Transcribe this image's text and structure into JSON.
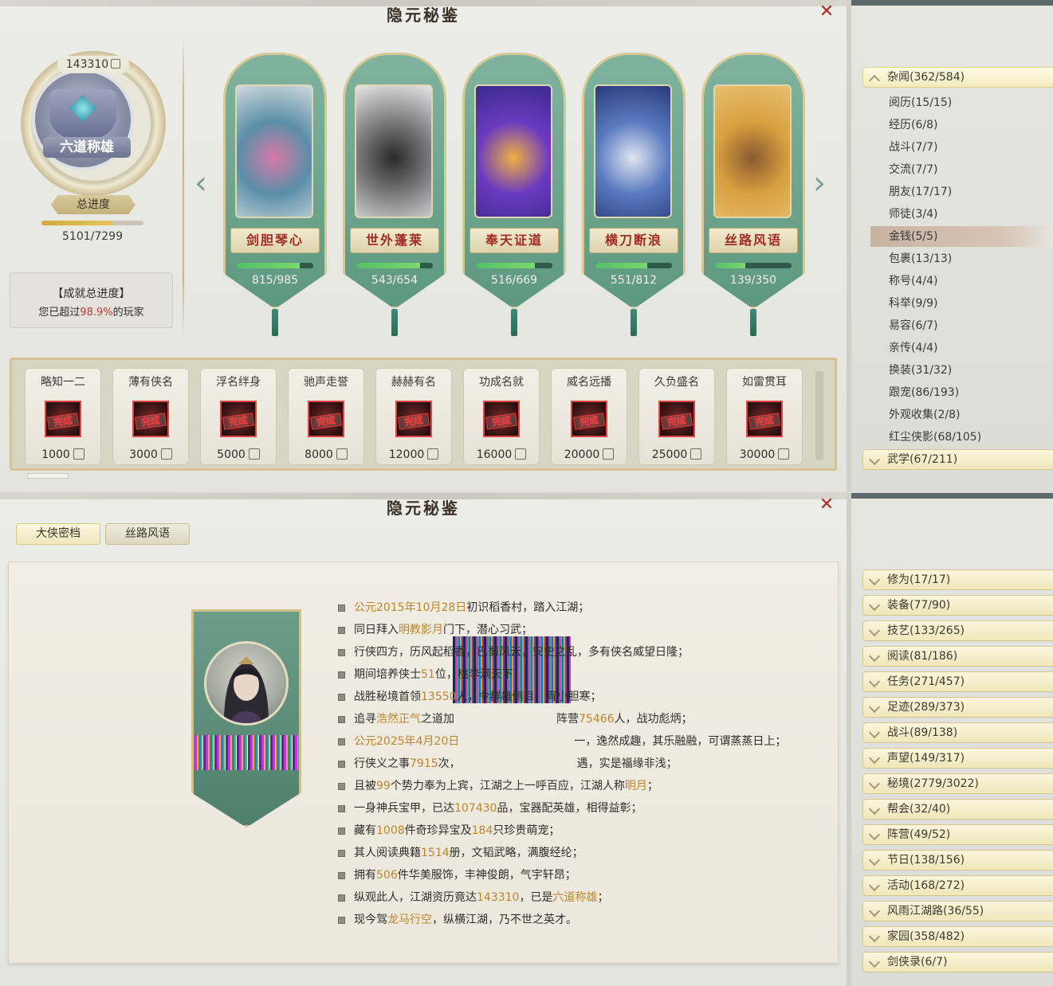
{
  "panel1": {
    "title": "隐元秘鉴",
    "profile": {
      "score": "143310",
      "medal_text": "六道称雄",
      "total_progress_label": "总进度",
      "total_progress_value": "5101/7299",
      "total_progress_fraction": 0.699,
      "achievement_title": "【成就总进度】",
      "achievement_prefix": "您已超过",
      "achievement_percent": "98.9%",
      "achievement_suffix": "的玩家"
    },
    "cards": [
      {
        "name": "剑胆琴心",
        "progress": "815/985",
        "fraction": 0.827
      },
      {
        "name": "世外蓬莱",
        "progress": "543/654",
        "fraction": 0.83
      },
      {
        "name": "奉天证道",
        "progress": "516/669",
        "fraction": 0.771
      },
      {
        "name": "横刀断浪",
        "progress": "551/812",
        "fraction": 0.679
      },
      {
        "name": "丝路风语",
        "progress": "139/350",
        "fraction": 0.397
      }
    ],
    "rewards": [
      {
        "name": "略知一二",
        "stamp": "完成",
        "cost": "1000"
      },
      {
        "name": "薄有侠名",
        "stamp": "完成",
        "cost": "3000"
      },
      {
        "name": "浮名绊身",
        "stamp": "完成",
        "cost": "5000"
      },
      {
        "name": "驰声走誉",
        "stamp": "完成",
        "cost": "8000"
      },
      {
        "name": "赫赫有名",
        "stamp": "完成",
        "cost": "12000"
      },
      {
        "name": "功成名就",
        "stamp": "完成",
        "cost": "16000"
      },
      {
        "name": "威名远播",
        "stamp": "完成",
        "cost": "20000"
      },
      {
        "name": "久负盛名",
        "stamp": "完成",
        "cost": "25000"
      },
      {
        "name": "如雷贯耳",
        "stamp": "完成",
        "cost": "30000"
      }
    ]
  },
  "sidebar1": {
    "header": "杂闻(362/584)",
    "items": [
      "阅历(15/15)",
      "经历(6/8)",
      "战斗(7/7)",
      "交流(7/7)",
      "朋友(17/17)",
      "师徒(3/4)",
      "金钱(5/5)",
      "包裹(13/13)",
      "称号(4/4)",
      "科举(9/9)",
      "易容(6/7)",
      "亲传(4/4)",
      "换装(31/32)",
      "跟宠(86/193)",
      "外观收集(2/8)",
      "红尘侠影(68/105)"
    ],
    "selected": "金钱(5/5)",
    "footer": "武学(67/211)"
  },
  "panel2": {
    "title": "隐元秘鉴",
    "tabs": [
      "大侠密档",
      "丝路风语"
    ],
    "bio": [
      [
        {
          "t": "公元2015年10月28日",
          "h": true
        },
        {
          "t": "初识稻香村，踏入江湖；"
        }
      ],
      [
        {
          "t": "同日拜入"
        },
        {
          "t": "明教影月",
          "h": true
        },
        {
          "t": "门下，潜心习武；"
        }
      ],
      [
        {
          "t": "行侠四方，历风起稻香，巴蜀风云，安史之乱，多有侠名威望日隆；"
        }
      ],
      [
        {
          "t": "期间培养侠士"
        },
        {
          "t": "51",
          "h": true
        },
        {
          "t": "位，桃李满天下；"
        }
      ],
      [
        {
          "t": "战胜秘境首领"
        },
        {
          "t": "13550",
          "h": true
        },
        {
          "t": "人，令群雄侧目，宵小胆寒；"
        }
      ],
      [
        {
          "t": "追寻"
        },
        {
          "t": "浩然正气",
          "h": true
        },
        {
          "t": "之道加"
        },
        {
          "t": "gap"
        },
        {
          "t": "阵营"
        },
        {
          "t": "75466",
          "h": true
        },
        {
          "t": "人，战功彪炳；"
        }
      ],
      [
        {
          "t": "公元2025年4月20日",
          "h": true
        },
        {
          "t": "gap"
        },
        {
          "t": "一，逸然成趣，其乐融融，可谓蒸蒸日上；"
        }
      ],
      [
        {
          "t": "行侠义之事"
        },
        {
          "t": "7915",
          "h": true
        },
        {
          "t": "次，"
        },
        {
          "t": "gap"
        },
        {
          "t": "遇，实是福缘非浅；"
        }
      ],
      [
        {
          "t": "且被"
        },
        {
          "t": "99",
          "h": true
        },
        {
          "t": "个势力奉为上宾，江湖之上一呼百应，江湖人称"
        },
        {
          "t": "明月",
          "h": true
        },
        {
          "t": "；"
        }
      ],
      [
        {
          "t": "一身神兵宝甲，已达"
        },
        {
          "t": "107430",
          "h": true
        },
        {
          "t": "品，宝器配英雄，相得益彰；"
        }
      ],
      [
        {
          "t": "藏有"
        },
        {
          "t": "1008",
          "h": true
        },
        {
          "t": "件奇珍异宝及"
        },
        {
          "t": "184",
          "h": true
        },
        {
          "t": "只珍贵萌宠；"
        }
      ],
      [
        {
          "t": "其人阅读典籍"
        },
        {
          "t": "1514",
          "h": true
        },
        {
          "t": "册，文韬武略，满腹经纶；"
        }
      ],
      [
        {
          "t": "拥有"
        },
        {
          "t": "506",
          "h": true
        },
        {
          "t": "件华美服饰，丰神俊朗，气宇轩昂；"
        }
      ],
      [
        {
          "t": "纵观此人，江湖资历竟达"
        },
        {
          "t": "143310",
          "h": true
        },
        {
          "t": "，已是"
        },
        {
          "t": "六道称雄",
          "h": true
        },
        {
          "t": "；"
        }
      ],
      [
        {
          "t": "现今驾"
        },
        {
          "t": "龙马行空",
          "h": true
        },
        {
          "t": "，纵横江湖，乃不世之英才。"
        }
      ]
    ]
  },
  "sidebar2": {
    "items": [
      "修为(17/17)",
      "装备(77/90)",
      "技艺(133/265)",
      "阅读(81/186)",
      "任务(271/457)",
      "足迹(289/373)",
      "战斗(89/138)",
      "声望(149/317)",
      "秘境(2779/3022)",
      "帮会(32/40)",
      "阵营(49/52)",
      "节日(138/156)",
      "活动(168/272)",
      "风雨江湖路(36/55)",
      "家园(358/482)",
      "剑侠录(6/7)"
    ]
  },
  "colors": {
    "accent_gold": "#c2862a",
    "close_red": "#b02a25",
    "card_green": "#5e987f",
    "progress_green": "#52c16a",
    "card_name_red": "#a22c22"
  },
  "icons": {
    "close": "close-icon",
    "arrow_left": "arrow-left-icon",
    "arrow_right": "arrow-right-icon",
    "coin": "coin-icon",
    "chevron": "chevron-icon"
  }
}
